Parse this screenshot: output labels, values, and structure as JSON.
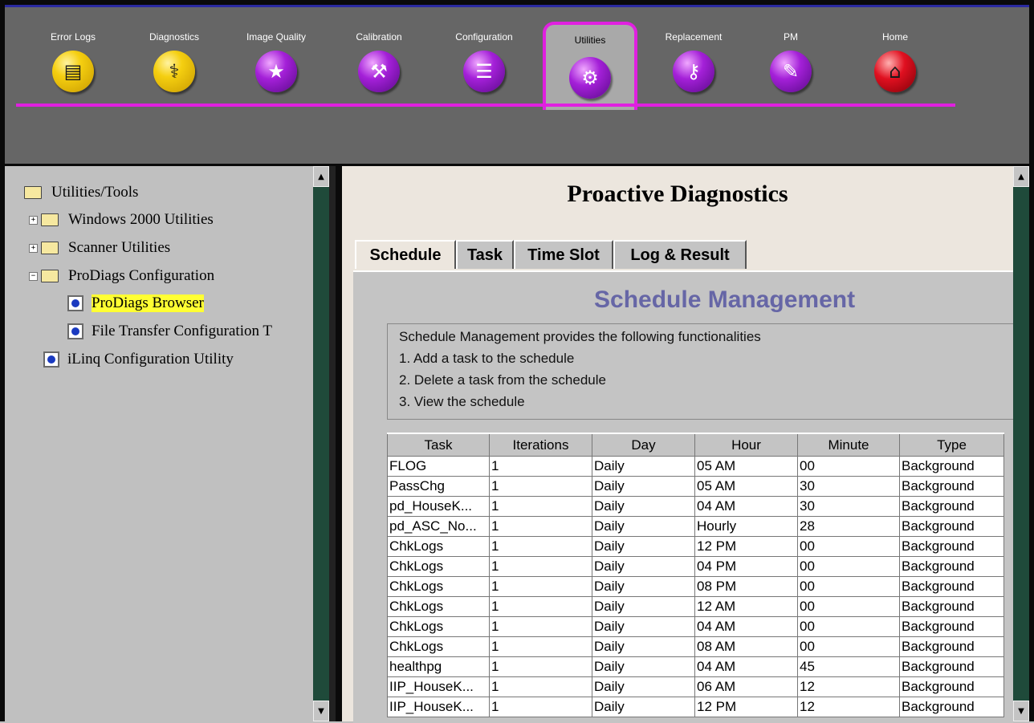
{
  "nav": {
    "tabs": [
      {
        "label": "Error Logs",
        "icon": "log-panel-icon",
        "glyph": "▤",
        "color": "yellow"
      },
      {
        "label": "Diagnostics",
        "icon": "stethoscope-icon",
        "glyph": "⚕",
        "color": "yellow"
      },
      {
        "label": "Image Quality",
        "icon": "monitor-star-icon",
        "glyph": "★",
        "color": "purple"
      },
      {
        "label": "Calibration",
        "icon": "wrench-icon",
        "glyph": "⚒",
        "color": "purple"
      },
      {
        "label": "Configuration",
        "icon": "checklist-icon",
        "glyph": "☰",
        "color": "purple"
      },
      {
        "label": "Utilities",
        "icon": "toolbox-icon",
        "glyph": "⚙",
        "color": "purple"
      },
      {
        "label": "Replacement",
        "icon": "replace-tool-icon",
        "glyph": "⚷",
        "color": "red"
      },
      {
        "label": "PM",
        "icon": "clipboard-icon",
        "glyph": "✎",
        "color": "purple"
      },
      {
        "label": "Home",
        "icon": "home-icon",
        "glyph": "⌂",
        "color": "red"
      }
    ],
    "active": "Utilities",
    "accent_color": "#e020e0"
  },
  "tree": {
    "root": "Utilities/Tools",
    "items": [
      {
        "label": "Windows 2000 Utilities",
        "type": "folder",
        "expander": "+"
      },
      {
        "label": "Scanner Utilities",
        "type": "folder",
        "expander": "+"
      },
      {
        "label": "ProDiags Configuration",
        "type": "folder-open",
        "expander": "−"
      },
      {
        "label": "ProDiags Browser",
        "type": "page",
        "selected": true
      },
      {
        "label": "File Transfer Configuration T",
        "type": "page"
      },
      {
        "label": "iLinq Configuration Utility",
        "type": "page"
      }
    ]
  },
  "main": {
    "title": "Proactive Diagnostics",
    "tabs": [
      "Schedule",
      "Task",
      "Time Slot",
      "Log & Result"
    ],
    "active_tab": "Schedule",
    "section_title": "Schedule Management",
    "description": [
      "Schedule Management provides the following functionalities",
      "1. Add a task to the schedule",
      "2. Delete a task from the schedule",
      "3. View the schedule"
    ],
    "table": {
      "columns": [
        "Task",
        "Iterations",
        "Day",
        "Hour",
        "Minute",
        "Type"
      ],
      "rows": [
        [
          "FLOG",
          "1",
          "Daily",
          "05 AM",
          "00",
          "Background"
        ],
        [
          "PassChg",
          "1",
          "Daily",
          "05 AM",
          "30",
          "Background"
        ],
        [
          "pd_HouseK...",
          "1",
          "Daily",
          "04 AM",
          "30",
          "Background"
        ],
        [
          "pd_ASC_No...",
          "1",
          "Daily",
          "Hourly",
          "28",
          "Background"
        ],
        [
          "ChkLogs",
          "1",
          "Daily",
          "12 PM",
          "00",
          "Background"
        ],
        [
          "ChkLogs",
          "1",
          "Daily",
          "04 PM",
          "00",
          "Background"
        ],
        [
          "ChkLogs",
          "1",
          "Daily",
          "08 PM",
          "00",
          "Background"
        ],
        [
          "ChkLogs",
          "1",
          "Daily",
          "12 AM",
          "00",
          "Background"
        ],
        [
          "ChkLogs",
          "1",
          "Daily",
          "04 AM",
          "00",
          "Background"
        ],
        [
          "ChkLogs",
          "1",
          "Daily",
          "08 AM",
          "00",
          "Background"
        ],
        [
          "healthpg",
          "1",
          "Daily",
          "04 AM",
          "45",
          "Background"
        ],
        [
          "IIP_HouseK...",
          "1",
          "Daily",
          "06 AM",
          "12",
          "Background"
        ],
        [
          "IIP_HouseK...",
          "1",
          "Daily",
          "12 PM",
          "12",
          "Background"
        ]
      ]
    }
  }
}
